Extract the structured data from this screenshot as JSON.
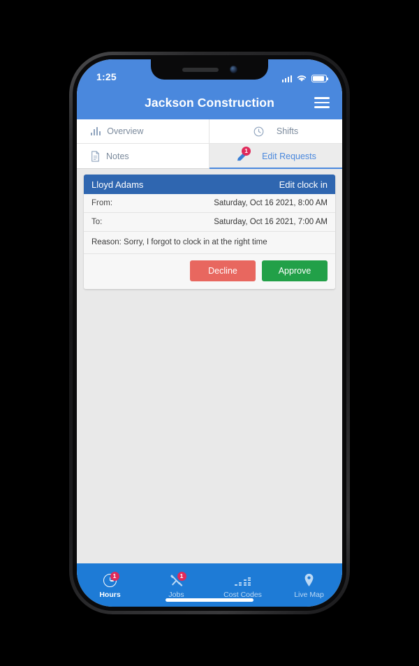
{
  "status_bar": {
    "time": "1:25",
    "cellular_icon": "cellular-bars-icon",
    "wifi_icon": "wifi-icon",
    "battery_icon": "battery-icon"
  },
  "app_bar": {
    "title": "Jackson Construction",
    "menu_icon": "hamburger-menu-icon"
  },
  "tabs": [
    {
      "label": "Overview",
      "icon": "bar-chart-icon",
      "active": false,
      "badge": ""
    },
    {
      "label": "Shifts",
      "icon": "clock-icon",
      "active": false,
      "badge": ""
    },
    {
      "label": "Notes",
      "icon": "document-icon",
      "active": false,
      "badge": ""
    },
    {
      "label": "Edit Requests",
      "icon": "pencil-icon",
      "active": true,
      "badge": "1"
    }
  ],
  "request_card": {
    "employee_name": "Lloyd Adams",
    "request_type": "Edit clock in",
    "from_label": "From:",
    "from_value": "Saturday, Oct 16 2021, 8:00 AM",
    "to_label": "To:",
    "to_value": "Saturday, Oct 16 2021, 7:00 AM",
    "reason": "Reason: Sorry, I forgot to clock in at the right time",
    "decline_label": "Decline",
    "approve_label": "Approve"
  },
  "bottom_nav": [
    {
      "label": "Hours",
      "icon": "clock-icon",
      "active": true,
      "badge": "1"
    },
    {
      "label": "Jobs",
      "icon": "tools-icon",
      "active": false,
      "badge": "1"
    },
    {
      "label": "Cost Codes",
      "icon": "bar-chart-icon",
      "active": false,
      "badge": ""
    },
    {
      "label": "Live Map",
      "icon": "map-pin-icon",
      "active": false,
      "badge": ""
    }
  ],
  "colors": {
    "header_blue": "#4a88dd",
    "card_header_blue": "#2f66b0",
    "nav_blue": "#1e7bd6",
    "badge_red": "#e02a5b",
    "decline_red": "#e8675f",
    "approve_green": "#22a048",
    "content_gray": "#e9e9e9"
  }
}
